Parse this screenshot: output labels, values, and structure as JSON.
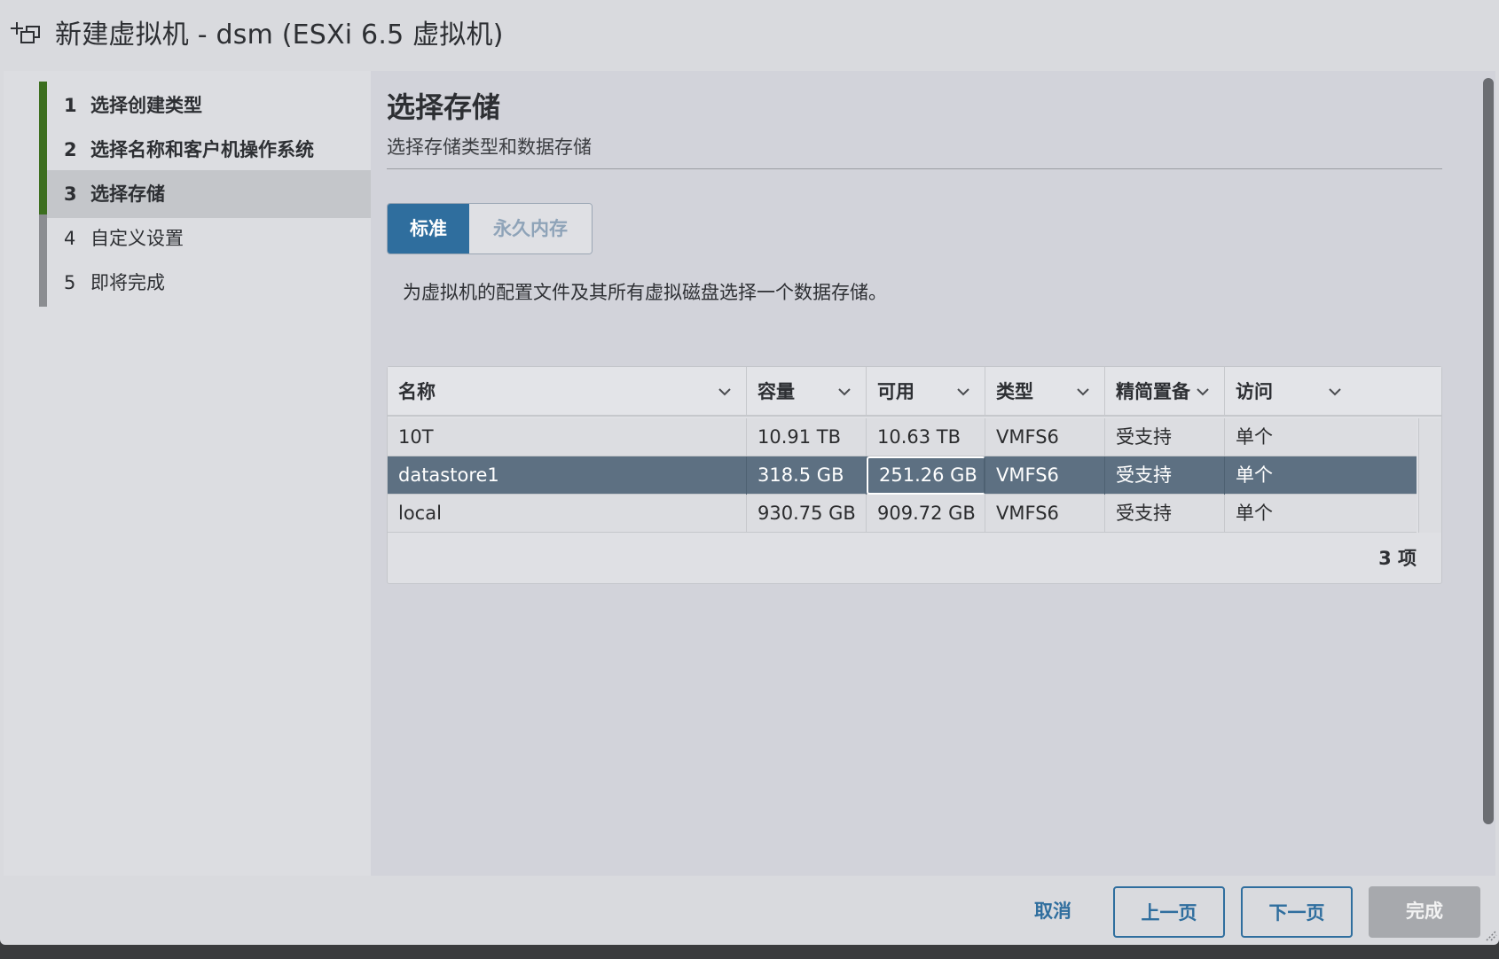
{
  "window": {
    "title": "新建虚拟机 - dsm (ESXi 6.5 虚拟机)",
    "icon": "new-vm-icon"
  },
  "steps": [
    {
      "num": "1",
      "label": "选择创建类型",
      "state": "done"
    },
    {
      "num": "2",
      "label": "选择名称和客户机操作系统",
      "state": "done"
    },
    {
      "num": "3",
      "label": "选择存储",
      "state": "current"
    },
    {
      "num": "4",
      "label": "自定义设置",
      "state": "pending"
    },
    {
      "num": "5",
      "label": "即将完成",
      "state": "pending"
    }
  ],
  "main": {
    "title": "选择存储",
    "subtitle": "选择存储类型和数据存储",
    "tabs": [
      {
        "label": "标准",
        "active": true
      },
      {
        "label": "永久内存",
        "active": false
      }
    ],
    "description": "为虚拟机的配置文件及其所有虚拟磁盘选择一个数据存储。"
  },
  "table": {
    "columns": [
      "名称",
      "容量",
      "可用",
      "类型",
      "精简置备",
      "访问"
    ],
    "rows": [
      {
        "name": "10T",
        "capacity": "10.91 TB",
        "free": "10.63 TB",
        "type": "VMFS6",
        "thin": "受支持",
        "access": "单个",
        "selected": false
      },
      {
        "name": "datastore1",
        "capacity": "318.5 GB",
        "free": "251.26 GB",
        "type": "VMFS6",
        "thin": "受支持",
        "access": "单个",
        "selected": true
      },
      {
        "name": "local",
        "capacity": "930.75 GB",
        "free": "909.72 GB",
        "type": "VMFS6",
        "thin": "受支持",
        "access": "单个",
        "selected": false
      }
    ],
    "footer": "3 项"
  },
  "buttons": {
    "cancel": "取消",
    "back": "上一页",
    "next": "下一页",
    "finish": "完成"
  },
  "colors": {
    "accent": "#2f6e9e",
    "step_done": "#3c6e1f",
    "selected_row": "#5d7082",
    "disabled_button": "#a7a9ad"
  }
}
